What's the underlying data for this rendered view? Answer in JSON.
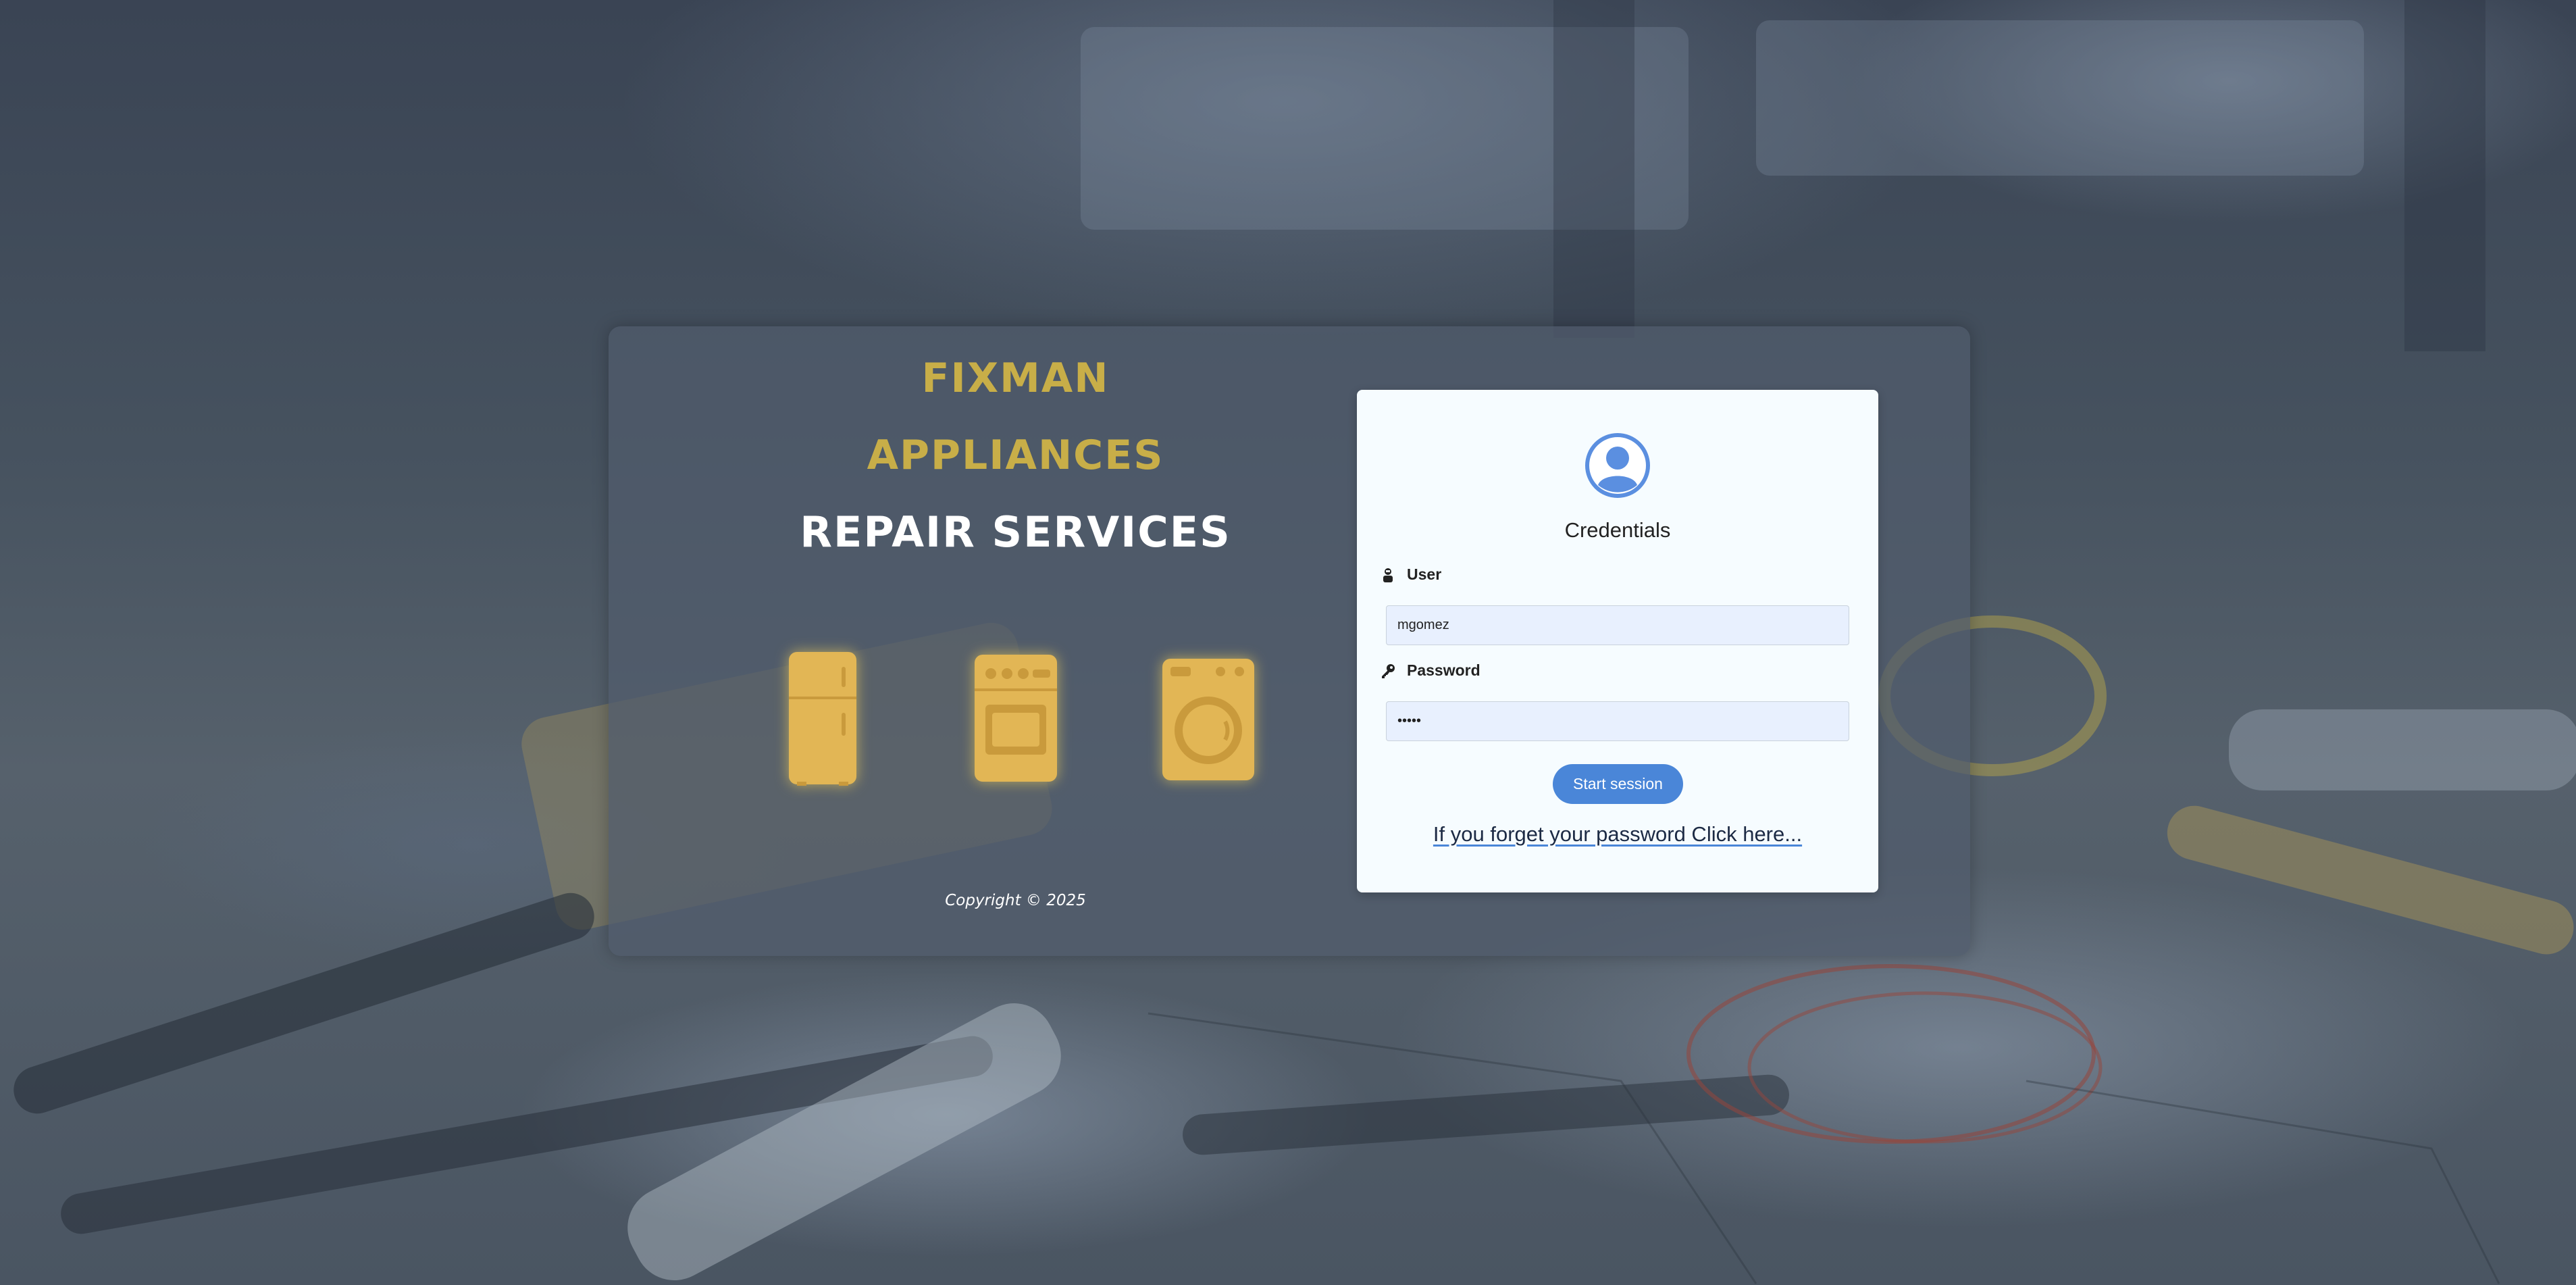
{
  "brand": {
    "line1": "FIXMAN",
    "line2": "APPLIANCES",
    "line3": "REPAIR SERVICES",
    "accent_color": "#c8ae48",
    "appliance_icons": [
      "refrigerator-icon",
      "stove-icon",
      "washing-machine-icon"
    ],
    "copyright": "Copyright © 2025"
  },
  "login": {
    "avatar_icon": "user-circle-icon",
    "title": "Credentials",
    "user_label": "User",
    "user_icon": "user-icon",
    "user_value": "mgomez",
    "password_label": "Password",
    "password_icon": "key-icon",
    "password_value": "•••••",
    "submit_label": "Start session",
    "forgot_link": "If you forget your password Click here...",
    "button_color": "#4a86d8"
  }
}
